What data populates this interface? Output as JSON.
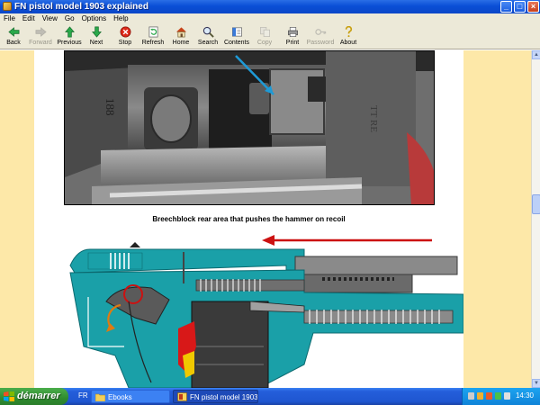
{
  "window": {
    "title": "FN pistol model 1903 explained",
    "controls": [
      "minimize",
      "maximize",
      "close"
    ]
  },
  "menu": [
    "File",
    "Edit",
    "View",
    "Go",
    "Options",
    "Help"
  ],
  "toolbar": [
    {
      "label": "Back",
      "icon": "back-arrow-icon",
      "enabled": true
    },
    {
      "label": "Forward",
      "icon": "forward-arrow-icon",
      "enabled": false
    },
    {
      "label": "Previous",
      "icon": "up-arrow-icon",
      "enabled": true
    },
    {
      "label": "Next",
      "icon": "down-arrow-icon",
      "enabled": true
    },
    {
      "label": "Stop",
      "icon": "stop-icon",
      "enabled": true
    },
    {
      "label": "Refresh",
      "icon": "refresh-icon",
      "enabled": true
    },
    {
      "label": "Home",
      "icon": "home-icon",
      "enabled": true
    },
    {
      "label": "Search",
      "icon": "search-icon",
      "enabled": true
    },
    {
      "label": "Contents",
      "icon": "contents-icon",
      "enabled": true
    },
    {
      "label": "Copy",
      "icon": "copy-icon",
      "enabled": false
    },
    {
      "label": "Print",
      "icon": "print-icon",
      "enabled": true
    },
    {
      "label": "Password",
      "icon": "key-icon",
      "enabled": false
    },
    {
      "label": "About",
      "icon": "about-icon",
      "enabled": true
    }
  ],
  "document": {
    "caption": "Breechblock rear area that pushes the hammer on recoil",
    "photo_marking": "188",
    "colors": {
      "page_margin": "#fde8a8",
      "frame_teal": "#1aa0a8",
      "recoil_arrow": "#cc1111",
      "pointer_arrow": "#1e9ad6"
    }
  },
  "taskbar": {
    "start_label": "démarrer",
    "language": "FR",
    "tasks": [
      {
        "label": "Ebooks",
        "active": false
      },
      {
        "label": "FN pistol model 1903 ...",
        "active": true
      }
    ],
    "clock": "14:30"
  }
}
